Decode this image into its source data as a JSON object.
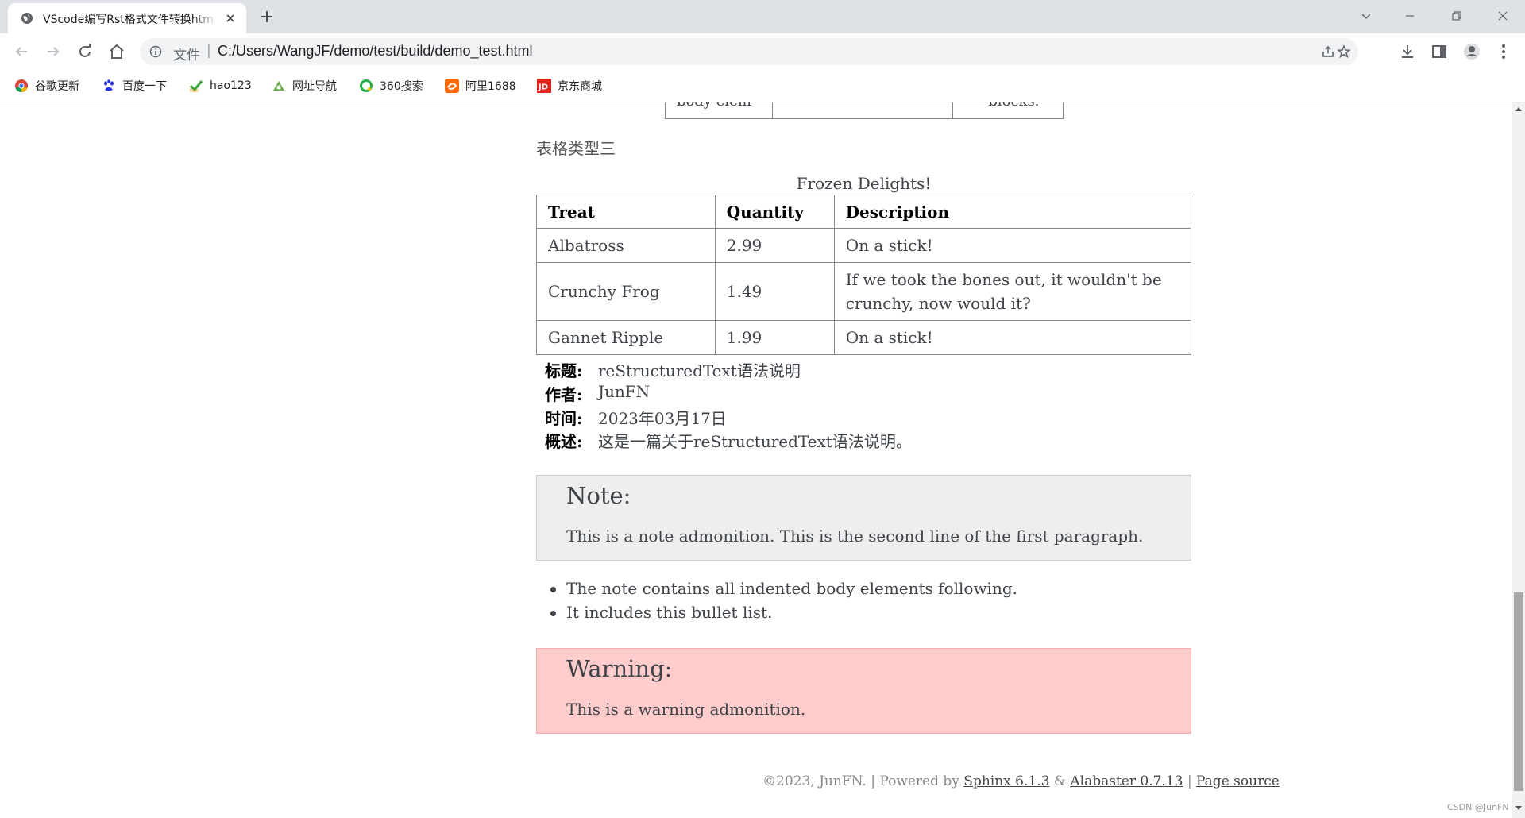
{
  "browser": {
    "tab_title": "VScode编写Rst格式文件转换htm",
    "address_scheme": "文件",
    "address_sep": "|",
    "url": "C:/Users/WangJF/demo/test/build/demo_test.html",
    "bookmarks": [
      {
        "label": "谷歌更新",
        "icon": "chrome-icon"
      },
      {
        "label": "百度一下",
        "icon": "baidu-paw-icon"
      },
      {
        "label": "hao123",
        "icon": "hao123-icon"
      },
      {
        "label": "网址导航",
        "icon": "nav-icon"
      },
      {
        "label": "360搜索",
        "icon": "360-search-icon"
      },
      {
        "label": "阿里1688",
        "icon": "alibaba-icon"
      },
      {
        "label": "京东商城",
        "icon": "jd-icon"
      }
    ]
  },
  "page": {
    "prev_table_text": "body elem",
    "prev_table_text2": "• blocks.",
    "section_label": "表格类型三",
    "table": {
      "caption": "Frozen Delights!",
      "headers": [
        "Treat",
        "Quantity",
        "Description"
      ],
      "rows": [
        [
          "Albatross",
          "2.99",
          "On a stick!"
        ],
        [
          "Crunchy Frog",
          "1.49",
          "If we took the bones out, it wouldn't be crunchy, now would it?"
        ],
        [
          "Gannet Ripple",
          "1.99",
          "On a stick!"
        ]
      ]
    },
    "fields": [
      {
        "name": "标题:",
        "value": "reStructuredText语法说明"
      },
      {
        "name": "作者:",
        "value": "JunFN"
      },
      {
        "name": "时间:",
        "value": "2023年03月17日"
      },
      {
        "name": "概述:",
        "value": "这是一篇关于reStructuredText语法说明。"
      }
    ],
    "note": {
      "title": "Note:",
      "body": "This is a note admonition. This is the second line of the first paragraph."
    },
    "bullets": [
      "The note contains all indented body elements following.",
      "It includes this bullet list."
    ],
    "warning": {
      "title": "Warning:",
      "body": "This is a warning admonition."
    },
    "footer": {
      "copyright": "©2023, JunFN.",
      "sep1": "|",
      "powered": "Powered by",
      "sphinx": "Sphinx 6.1.3",
      "amp": "&",
      "alabaster": "Alabaster 0.7.13",
      "sep2": "|",
      "source": "Page source"
    },
    "watermark": "CSDN @JunFN"
  },
  "colors": {
    "note_bg": "#eeeeee",
    "warning_bg": "#ffcccc",
    "text": "#3e4349"
  }
}
